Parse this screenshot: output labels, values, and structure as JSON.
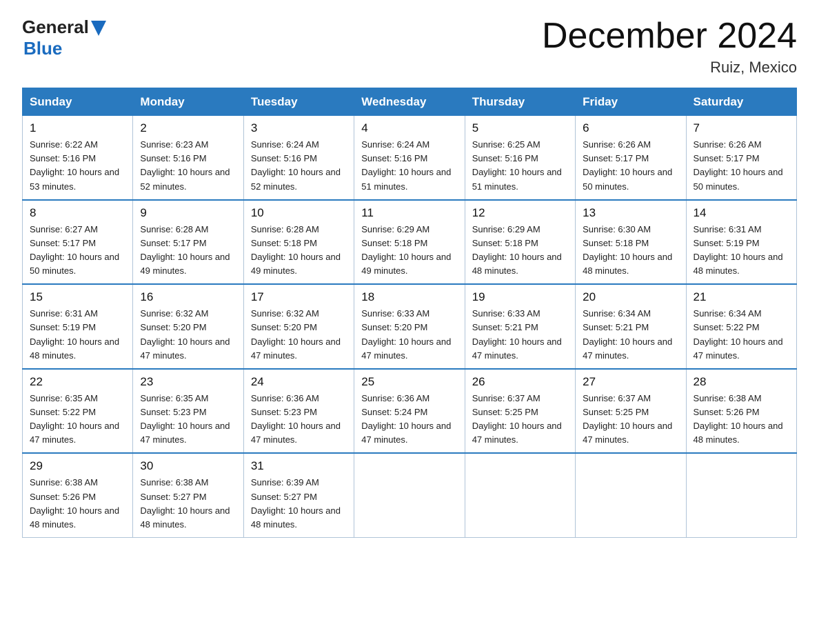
{
  "header": {
    "logo_general": "General",
    "logo_blue": "Blue",
    "month_title": "December 2024",
    "location": "Ruiz, Mexico"
  },
  "days_of_week": [
    "Sunday",
    "Monday",
    "Tuesday",
    "Wednesday",
    "Thursday",
    "Friday",
    "Saturday"
  ],
  "weeks": [
    [
      {
        "day": "1",
        "sunrise": "6:22 AM",
        "sunset": "5:16 PM",
        "daylight": "10 hours and 53 minutes."
      },
      {
        "day": "2",
        "sunrise": "6:23 AM",
        "sunset": "5:16 PM",
        "daylight": "10 hours and 52 minutes."
      },
      {
        "day": "3",
        "sunrise": "6:24 AM",
        "sunset": "5:16 PM",
        "daylight": "10 hours and 52 minutes."
      },
      {
        "day": "4",
        "sunrise": "6:24 AM",
        "sunset": "5:16 PM",
        "daylight": "10 hours and 51 minutes."
      },
      {
        "day": "5",
        "sunrise": "6:25 AM",
        "sunset": "5:16 PM",
        "daylight": "10 hours and 51 minutes."
      },
      {
        "day": "6",
        "sunrise": "6:26 AM",
        "sunset": "5:17 PM",
        "daylight": "10 hours and 50 minutes."
      },
      {
        "day": "7",
        "sunrise": "6:26 AM",
        "sunset": "5:17 PM",
        "daylight": "10 hours and 50 minutes."
      }
    ],
    [
      {
        "day": "8",
        "sunrise": "6:27 AM",
        "sunset": "5:17 PM",
        "daylight": "10 hours and 50 minutes."
      },
      {
        "day": "9",
        "sunrise": "6:28 AM",
        "sunset": "5:17 PM",
        "daylight": "10 hours and 49 minutes."
      },
      {
        "day": "10",
        "sunrise": "6:28 AM",
        "sunset": "5:18 PM",
        "daylight": "10 hours and 49 minutes."
      },
      {
        "day": "11",
        "sunrise": "6:29 AM",
        "sunset": "5:18 PM",
        "daylight": "10 hours and 49 minutes."
      },
      {
        "day": "12",
        "sunrise": "6:29 AM",
        "sunset": "5:18 PM",
        "daylight": "10 hours and 48 minutes."
      },
      {
        "day": "13",
        "sunrise": "6:30 AM",
        "sunset": "5:18 PM",
        "daylight": "10 hours and 48 minutes."
      },
      {
        "day": "14",
        "sunrise": "6:31 AM",
        "sunset": "5:19 PM",
        "daylight": "10 hours and 48 minutes."
      }
    ],
    [
      {
        "day": "15",
        "sunrise": "6:31 AM",
        "sunset": "5:19 PM",
        "daylight": "10 hours and 48 minutes."
      },
      {
        "day": "16",
        "sunrise": "6:32 AM",
        "sunset": "5:20 PM",
        "daylight": "10 hours and 47 minutes."
      },
      {
        "day": "17",
        "sunrise": "6:32 AM",
        "sunset": "5:20 PM",
        "daylight": "10 hours and 47 minutes."
      },
      {
        "day": "18",
        "sunrise": "6:33 AM",
        "sunset": "5:20 PM",
        "daylight": "10 hours and 47 minutes."
      },
      {
        "day": "19",
        "sunrise": "6:33 AM",
        "sunset": "5:21 PM",
        "daylight": "10 hours and 47 minutes."
      },
      {
        "day": "20",
        "sunrise": "6:34 AM",
        "sunset": "5:21 PM",
        "daylight": "10 hours and 47 minutes."
      },
      {
        "day": "21",
        "sunrise": "6:34 AM",
        "sunset": "5:22 PM",
        "daylight": "10 hours and 47 minutes."
      }
    ],
    [
      {
        "day": "22",
        "sunrise": "6:35 AM",
        "sunset": "5:22 PM",
        "daylight": "10 hours and 47 minutes."
      },
      {
        "day": "23",
        "sunrise": "6:35 AM",
        "sunset": "5:23 PM",
        "daylight": "10 hours and 47 minutes."
      },
      {
        "day": "24",
        "sunrise": "6:36 AM",
        "sunset": "5:23 PM",
        "daylight": "10 hours and 47 minutes."
      },
      {
        "day": "25",
        "sunrise": "6:36 AM",
        "sunset": "5:24 PM",
        "daylight": "10 hours and 47 minutes."
      },
      {
        "day": "26",
        "sunrise": "6:37 AM",
        "sunset": "5:25 PM",
        "daylight": "10 hours and 47 minutes."
      },
      {
        "day": "27",
        "sunrise": "6:37 AM",
        "sunset": "5:25 PM",
        "daylight": "10 hours and 47 minutes."
      },
      {
        "day": "28",
        "sunrise": "6:38 AM",
        "sunset": "5:26 PM",
        "daylight": "10 hours and 48 minutes."
      }
    ],
    [
      {
        "day": "29",
        "sunrise": "6:38 AM",
        "sunset": "5:26 PM",
        "daylight": "10 hours and 48 minutes."
      },
      {
        "day": "30",
        "sunrise": "6:38 AM",
        "sunset": "5:27 PM",
        "daylight": "10 hours and 48 minutes."
      },
      {
        "day": "31",
        "sunrise": "6:39 AM",
        "sunset": "5:27 PM",
        "daylight": "10 hours and 48 minutes."
      },
      null,
      null,
      null,
      null
    ]
  ]
}
